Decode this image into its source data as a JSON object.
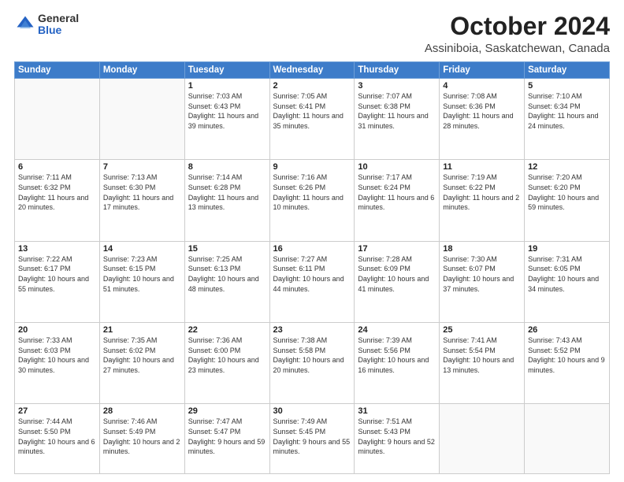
{
  "logo": {
    "general": "General",
    "blue": "Blue"
  },
  "header": {
    "month": "October 2024",
    "location": "Assiniboia, Saskatchewan, Canada"
  },
  "weekdays": [
    "Sunday",
    "Monday",
    "Tuesday",
    "Wednesday",
    "Thursday",
    "Friday",
    "Saturday"
  ],
  "weeks": [
    [
      {
        "day": "",
        "info": ""
      },
      {
        "day": "",
        "info": ""
      },
      {
        "day": "1",
        "sunrise": "Sunrise: 7:03 AM",
        "sunset": "Sunset: 6:43 PM",
        "daylight": "Daylight: 11 hours and 39 minutes."
      },
      {
        "day": "2",
        "sunrise": "Sunrise: 7:05 AM",
        "sunset": "Sunset: 6:41 PM",
        "daylight": "Daylight: 11 hours and 35 minutes."
      },
      {
        "day": "3",
        "sunrise": "Sunrise: 7:07 AM",
        "sunset": "Sunset: 6:38 PM",
        "daylight": "Daylight: 11 hours and 31 minutes."
      },
      {
        "day": "4",
        "sunrise": "Sunrise: 7:08 AM",
        "sunset": "Sunset: 6:36 PM",
        "daylight": "Daylight: 11 hours and 28 minutes."
      },
      {
        "day": "5",
        "sunrise": "Sunrise: 7:10 AM",
        "sunset": "Sunset: 6:34 PM",
        "daylight": "Daylight: 11 hours and 24 minutes."
      }
    ],
    [
      {
        "day": "6",
        "sunrise": "Sunrise: 7:11 AM",
        "sunset": "Sunset: 6:32 PM",
        "daylight": "Daylight: 11 hours and 20 minutes."
      },
      {
        "day": "7",
        "sunrise": "Sunrise: 7:13 AM",
        "sunset": "Sunset: 6:30 PM",
        "daylight": "Daylight: 11 hours and 17 minutes."
      },
      {
        "day": "8",
        "sunrise": "Sunrise: 7:14 AM",
        "sunset": "Sunset: 6:28 PM",
        "daylight": "Daylight: 11 hours and 13 minutes."
      },
      {
        "day": "9",
        "sunrise": "Sunrise: 7:16 AM",
        "sunset": "Sunset: 6:26 PM",
        "daylight": "Daylight: 11 hours and 10 minutes."
      },
      {
        "day": "10",
        "sunrise": "Sunrise: 7:17 AM",
        "sunset": "Sunset: 6:24 PM",
        "daylight": "Daylight: 11 hours and 6 minutes."
      },
      {
        "day": "11",
        "sunrise": "Sunrise: 7:19 AM",
        "sunset": "Sunset: 6:22 PM",
        "daylight": "Daylight: 11 hours and 2 minutes."
      },
      {
        "day": "12",
        "sunrise": "Sunrise: 7:20 AM",
        "sunset": "Sunset: 6:20 PM",
        "daylight": "Daylight: 10 hours and 59 minutes."
      }
    ],
    [
      {
        "day": "13",
        "sunrise": "Sunrise: 7:22 AM",
        "sunset": "Sunset: 6:17 PM",
        "daylight": "Daylight: 10 hours and 55 minutes."
      },
      {
        "day": "14",
        "sunrise": "Sunrise: 7:23 AM",
        "sunset": "Sunset: 6:15 PM",
        "daylight": "Daylight: 10 hours and 51 minutes."
      },
      {
        "day": "15",
        "sunrise": "Sunrise: 7:25 AM",
        "sunset": "Sunset: 6:13 PM",
        "daylight": "Daylight: 10 hours and 48 minutes."
      },
      {
        "day": "16",
        "sunrise": "Sunrise: 7:27 AM",
        "sunset": "Sunset: 6:11 PM",
        "daylight": "Daylight: 10 hours and 44 minutes."
      },
      {
        "day": "17",
        "sunrise": "Sunrise: 7:28 AM",
        "sunset": "Sunset: 6:09 PM",
        "daylight": "Daylight: 10 hours and 41 minutes."
      },
      {
        "day": "18",
        "sunrise": "Sunrise: 7:30 AM",
        "sunset": "Sunset: 6:07 PM",
        "daylight": "Daylight: 10 hours and 37 minutes."
      },
      {
        "day": "19",
        "sunrise": "Sunrise: 7:31 AM",
        "sunset": "Sunset: 6:05 PM",
        "daylight": "Daylight: 10 hours and 34 minutes."
      }
    ],
    [
      {
        "day": "20",
        "sunrise": "Sunrise: 7:33 AM",
        "sunset": "Sunset: 6:03 PM",
        "daylight": "Daylight: 10 hours and 30 minutes."
      },
      {
        "day": "21",
        "sunrise": "Sunrise: 7:35 AM",
        "sunset": "Sunset: 6:02 PM",
        "daylight": "Daylight: 10 hours and 27 minutes."
      },
      {
        "day": "22",
        "sunrise": "Sunrise: 7:36 AM",
        "sunset": "Sunset: 6:00 PM",
        "daylight": "Daylight: 10 hours and 23 minutes."
      },
      {
        "day": "23",
        "sunrise": "Sunrise: 7:38 AM",
        "sunset": "Sunset: 5:58 PM",
        "daylight": "Daylight: 10 hours and 20 minutes."
      },
      {
        "day": "24",
        "sunrise": "Sunrise: 7:39 AM",
        "sunset": "Sunset: 5:56 PM",
        "daylight": "Daylight: 10 hours and 16 minutes."
      },
      {
        "day": "25",
        "sunrise": "Sunrise: 7:41 AM",
        "sunset": "Sunset: 5:54 PM",
        "daylight": "Daylight: 10 hours and 13 minutes."
      },
      {
        "day": "26",
        "sunrise": "Sunrise: 7:43 AM",
        "sunset": "Sunset: 5:52 PM",
        "daylight": "Daylight: 10 hours and 9 minutes."
      }
    ],
    [
      {
        "day": "27",
        "sunrise": "Sunrise: 7:44 AM",
        "sunset": "Sunset: 5:50 PM",
        "daylight": "Daylight: 10 hours and 6 minutes."
      },
      {
        "day": "28",
        "sunrise": "Sunrise: 7:46 AM",
        "sunset": "Sunset: 5:49 PM",
        "daylight": "Daylight: 10 hours and 2 minutes."
      },
      {
        "day": "29",
        "sunrise": "Sunrise: 7:47 AM",
        "sunset": "Sunset: 5:47 PM",
        "daylight": "Daylight: 9 hours and 59 minutes."
      },
      {
        "day": "30",
        "sunrise": "Sunrise: 7:49 AM",
        "sunset": "Sunset: 5:45 PM",
        "daylight": "Daylight: 9 hours and 55 minutes."
      },
      {
        "day": "31",
        "sunrise": "Sunrise: 7:51 AM",
        "sunset": "Sunset: 5:43 PM",
        "daylight": "Daylight: 9 hours and 52 minutes."
      },
      {
        "day": "",
        "info": ""
      },
      {
        "day": "",
        "info": ""
      }
    ]
  ]
}
